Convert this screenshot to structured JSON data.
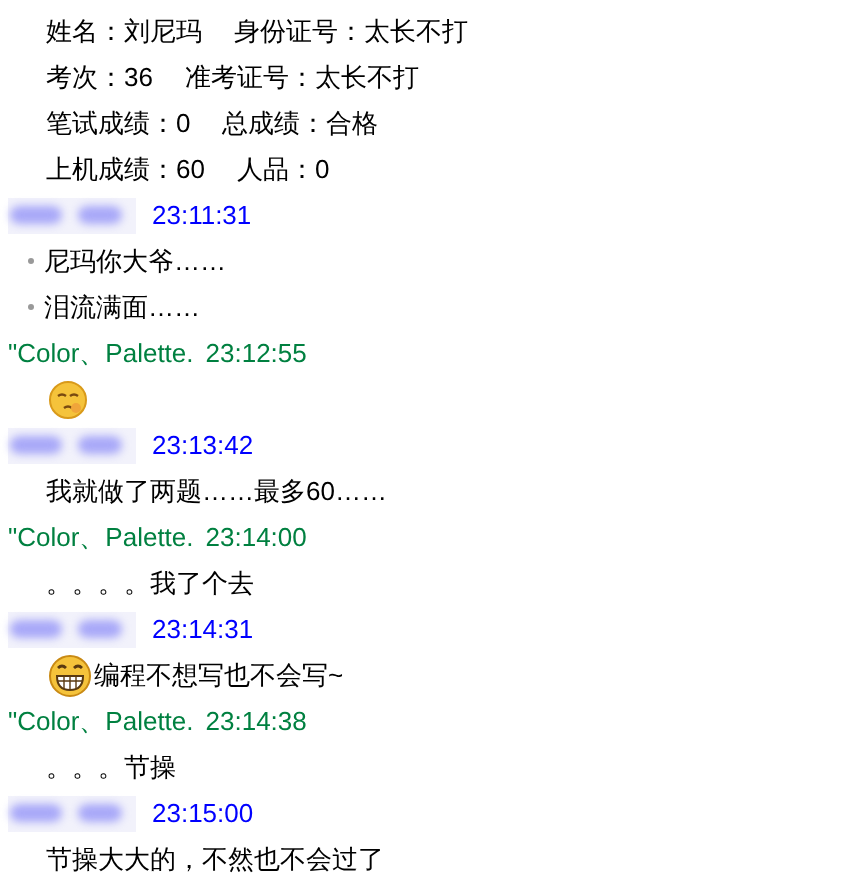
{
  "record": [
    [
      {
        "text": "姓名：刘尼玛"
      },
      {
        "text": "身份证号：太长不打"
      }
    ],
    [
      {
        "text": "考次：36"
      },
      {
        "text": "准考证号：太长不打"
      }
    ],
    [
      {
        "text": "笔试成绩：0"
      },
      {
        "text": "总成绩：合格"
      }
    ],
    [
      {
        "text": "上机成绩：60"
      },
      {
        "text": "人品：0"
      }
    ]
  ],
  "messages": [
    {
      "kind": "other",
      "time": "23:11:31",
      "lines": [
        {
          "kind": "bullet",
          "text": "尼玛你大爷……"
        },
        {
          "kind": "bullet",
          "text": "泪流满面……"
        }
      ]
    },
    {
      "kind": "self",
      "name": "\"Color、Palette.",
      "time": "23:12:55",
      "lines": [
        {
          "kind": "emoji"
        }
      ]
    },
    {
      "kind": "other",
      "time": "23:13:42",
      "lines": [
        {
          "kind": "text",
          "text": "我就做了两题……最多60……"
        }
      ]
    },
    {
      "kind": "self",
      "name": "\"Color、Palette.",
      "time": "23:14:00",
      "lines": [
        {
          "kind": "text",
          "text": "。。。。我了个去"
        }
      ]
    },
    {
      "kind": "other",
      "time": "23:14:31",
      "lines": [
        {
          "kind": "emoji-text",
          "text": "编程不想写也不会写~"
        }
      ]
    },
    {
      "kind": "self",
      "name": "\"Color、Palette.",
      "time": "23:14:38",
      "lines": [
        {
          "kind": "text",
          "text": "。。。节操"
        }
      ]
    },
    {
      "kind": "other",
      "time": "23:15:00",
      "lines": [
        {
          "kind": "text",
          "text": "节操大大的，不然也不会过了"
        }
      ]
    }
  ]
}
